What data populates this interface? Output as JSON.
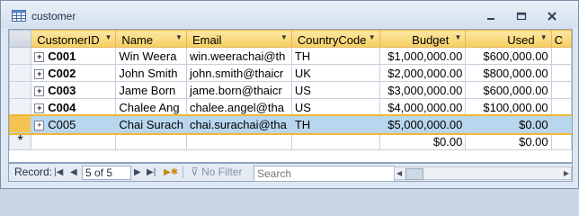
{
  "window": {
    "title": "customer",
    "icon": "table-icon",
    "controls": [
      "minimize-icon",
      "restore-icon",
      "close-icon"
    ]
  },
  "grid": {
    "columns": [
      {
        "label": "CustomerID"
      },
      {
        "label": "Name"
      },
      {
        "label": "Email"
      },
      {
        "label": "CountryCode"
      },
      {
        "label": "Budget"
      },
      {
        "label": "Used"
      },
      {
        "label": "C"
      }
    ],
    "rows": [
      {
        "id": "C001",
        "name": "Win Weera",
        "email": "win.weerachai@th",
        "country": "TH",
        "budget": "$1,000,000.00",
        "used": "$600,000.00"
      },
      {
        "id": "C002",
        "name": "John Smith",
        "email": "john.smith@thaicr",
        "country": "UK",
        "budget": "$2,000,000.00",
        "used": "$800,000.00"
      },
      {
        "id": "C003",
        "name": "Jame Born",
        "email": "jame.born@thaicr",
        "country": "US",
        "budget": "$3,000,000.00",
        "used": "$600,000.00"
      },
      {
        "id": "C004",
        "name": "Chalee Ang",
        "email": "chalee.angel@tha",
        "country": "US",
        "budget": "$4,000,000.00",
        "used": "$100,000.00"
      },
      {
        "id": "C005",
        "name": "Chai Surach",
        "email": "chai.surachai@tha",
        "country": "TH",
        "budget": "$5,000,000.00",
        "used": "$0.00"
      }
    ],
    "new_row": {
      "marker": "*",
      "budget": "$0.00",
      "used": "$0.00"
    },
    "selected_row_index": 4
  },
  "navigation": {
    "record_label": "Record:",
    "record_position": "5 of 5",
    "filter_label": "No Filter",
    "search_placeholder": "Search"
  }
}
